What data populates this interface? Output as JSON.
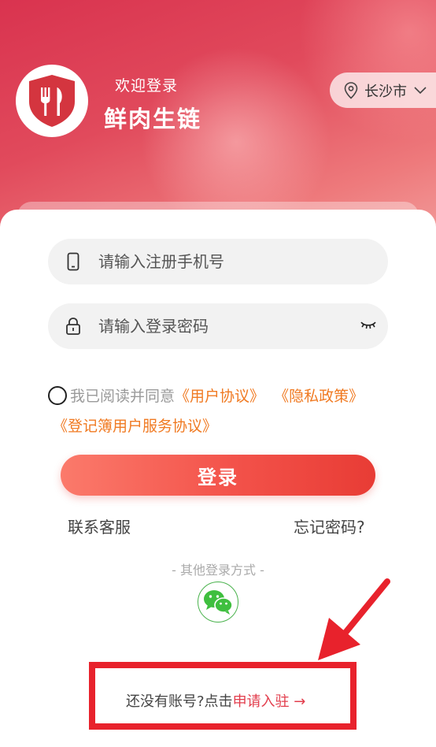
{
  "header": {
    "welcome": "欢迎登录",
    "brand": "鲜肉生链",
    "city": "长沙市",
    "logo_icon": "fork-knife-shield-icon"
  },
  "form": {
    "phone_placeholder": "请输入注册手机号",
    "password_placeholder": "请输入登录密码"
  },
  "agreement": {
    "prefix": "我已阅读并同意",
    "user_agreement": "《用户协议》",
    "privacy_policy": "《隐私政策》",
    "service_agreement": "《登记簿用户服务协议》"
  },
  "actions": {
    "login": "登录",
    "contact": "联系客服",
    "forgot": "忘记密码?",
    "other_login": "- 其他登录方式 -"
  },
  "register": {
    "prompt": "还没有账号?点击",
    "link": "申请入驻",
    "arrow": "→"
  },
  "colors": {
    "accent_orange": "#f07a22",
    "button_red": "#f3524a",
    "annotation_red": "#e8222c",
    "wechat_green": "#3fbf3f"
  }
}
